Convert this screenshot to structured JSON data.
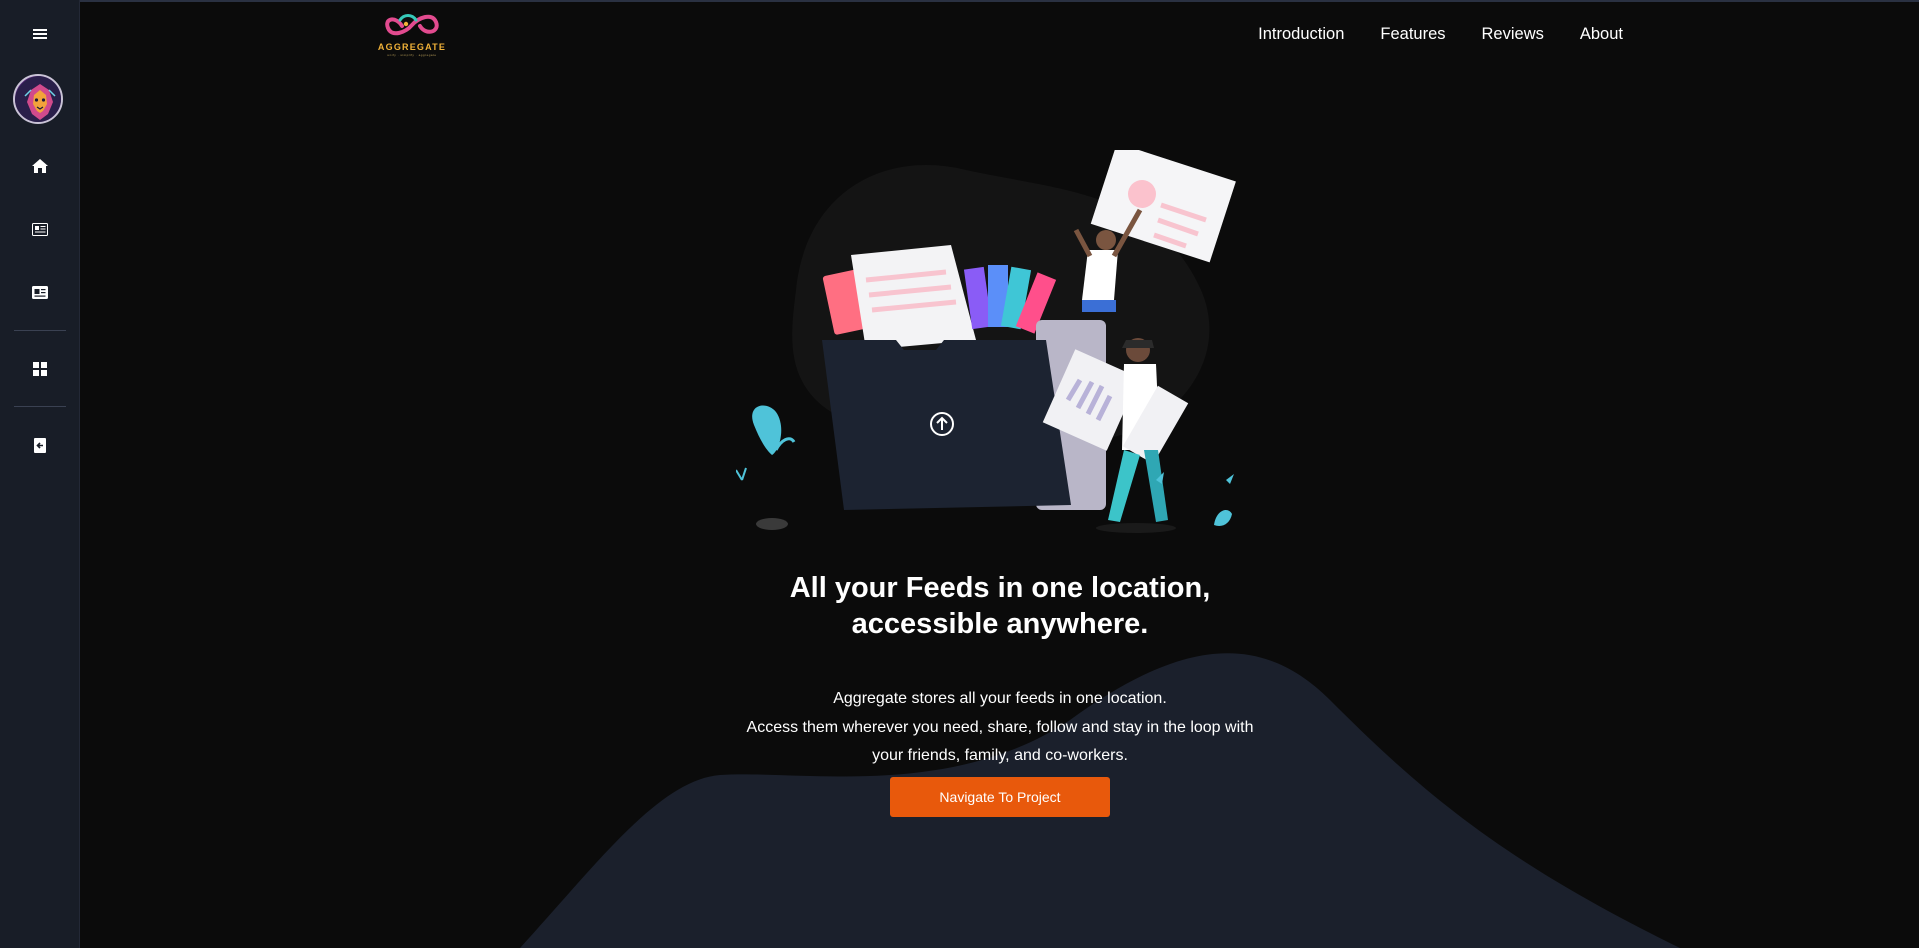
{
  "brand": {
    "name": "AGGREGATE",
    "tagline": "unify · simplify · aggregate",
    "accent": "#e8590c",
    "sidebar_bg": "#181d27",
    "page_bg": "#0b0b0b"
  },
  "sidebar": {
    "items": [
      {
        "icon": "hamburger-menu-icon"
      },
      {
        "icon": "avatar"
      },
      {
        "icon": "home-icon"
      },
      {
        "icon": "newspaper-icon"
      },
      {
        "icon": "feed-card-icon"
      },
      {
        "icon": "dashboard-grid-icon"
      },
      {
        "icon": "logout-icon"
      }
    ]
  },
  "nav": {
    "items": [
      {
        "label": "Introduction"
      },
      {
        "label": "Features"
      },
      {
        "label": "Reviews"
      },
      {
        "label": "About"
      }
    ]
  },
  "hero": {
    "title_line1": "All your Feeds in one location,",
    "title_line2": "accessible anywhere.",
    "text_line1": "Aggregate stores all your feeds in one location.",
    "text_line2": "Access them wherever you need, share, follow and stay in the loop with",
    "text_line3": "your friends, family, and co-workers.",
    "cta_label": "Navigate To Project"
  }
}
